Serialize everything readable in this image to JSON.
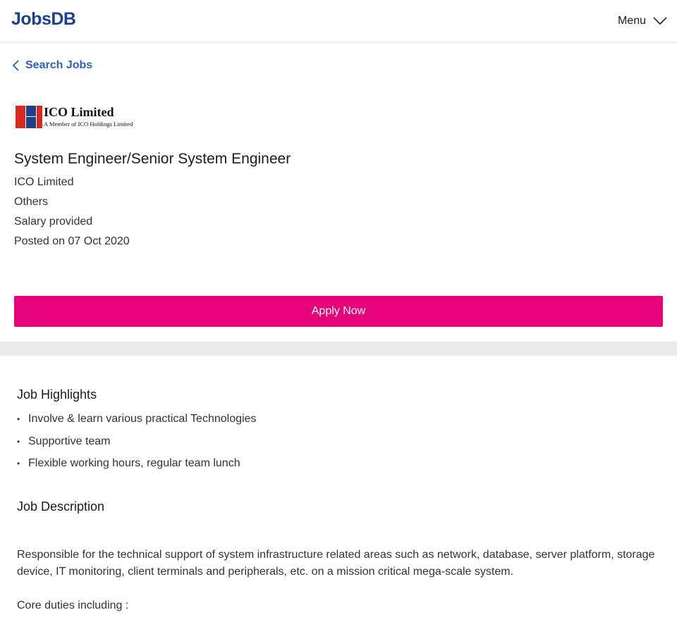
{
  "header": {
    "logo_text": "JobsDB",
    "menu_label": "Menu",
    "colors": {
      "logo": "#1c3f94"
    }
  },
  "nav": {
    "back_label": "Search Jobs",
    "back_icon": "chevron-left-icon"
  },
  "job": {
    "company_logo": {
      "name": "ICO Limited",
      "tagline": "A Member of ICO Holdings Limited"
    },
    "title": "System Engineer/Senior System Engineer",
    "company": "ICO Limited",
    "location": "Others",
    "salary": "Salary provided",
    "posted": "Posted on 07 Oct 2020"
  },
  "apply": {
    "label": "Apply Now",
    "color": "#e60278"
  },
  "highlights": {
    "heading": "Job Highlights",
    "items": [
      "Involve & learn various practical Technologies",
      "Supportive team",
      "Flexible working hours, regular team lunch"
    ]
  },
  "description": {
    "heading": "Job Description",
    "paragraphs": [
      "Responsible for the technical support of system infrastructure related areas such as network, database, server platform, storage device, IT monitoring, client terminals and peripherals, etc. on a mission critical mega-scale system.",
      "Core duties including :"
    ]
  }
}
